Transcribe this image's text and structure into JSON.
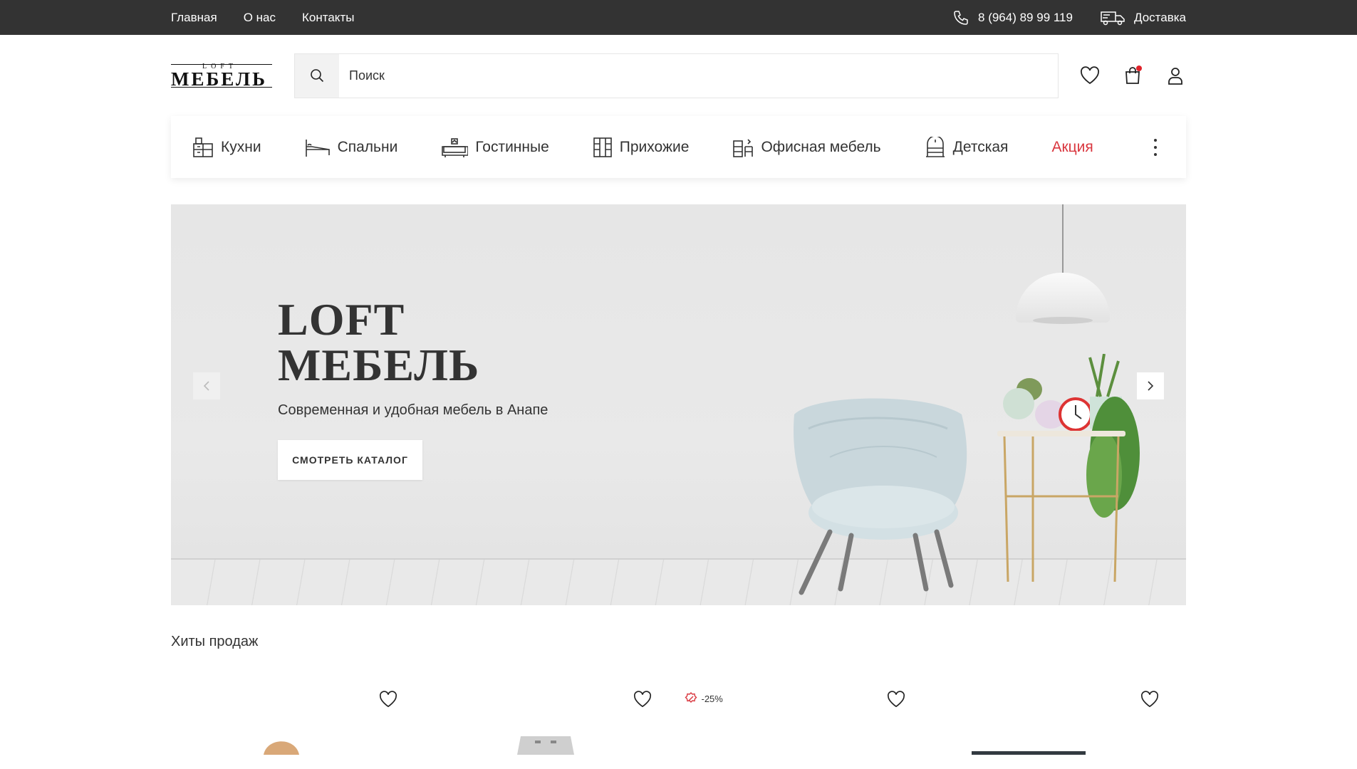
{
  "topbar": {
    "nav": [
      {
        "label": "Главная"
      },
      {
        "label": "О нас"
      },
      {
        "label": "Контакты"
      }
    ],
    "phone": "8 (964) 89 99 119",
    "delivery": "Доставка"
  },
  "header": {
    "logo_top": "LOFT",
    "logo_main": "МЕБЕЛЬ",
    "search_placeholder": "Поиск"
  },
  "categories": [
    {
      "label": "Кухни",
      "icon": "kitchen-icon"
    },
    {
      "label": "Спальни",
      "icon": "bed-icon"
    },
    {
      "label": "Гостинные",
      "icon": "sofa-icon"
    },
    {
      "label": "Прихожие",
      "icon": "wardrobe-icon"
    },
    {
      "label": "Офисная мебель",
      "icon": "office-icon"
    },
    {
      "label": "Детская",
      "icon": "kids-icon"
    },
    {
      "label": "Акция",
      "icon": null
    }
  ],
  "hero": {
    "title_line1": "LOFT",
    "title_line2": "МЕБЕЛЬ",
    "subtitle": "Современная и удобная мебель в Анапе",
    "button": "СМОТРЕТЬ КАТАЛОГ"
  },
  "hits": {
    "title": "Хиты продаж",
    "products": [
      {
        "badge": null
      },
      {
        "badge": null
      },
      {
        "badge": "-25%"
      },
      {
        "badge": null
      }
    ]
  },
  "colors": {
    "topbar_bg": "#333333",
    "sale": "#d9363e",
    "cart_dot": "#e0222a"
  }
}
